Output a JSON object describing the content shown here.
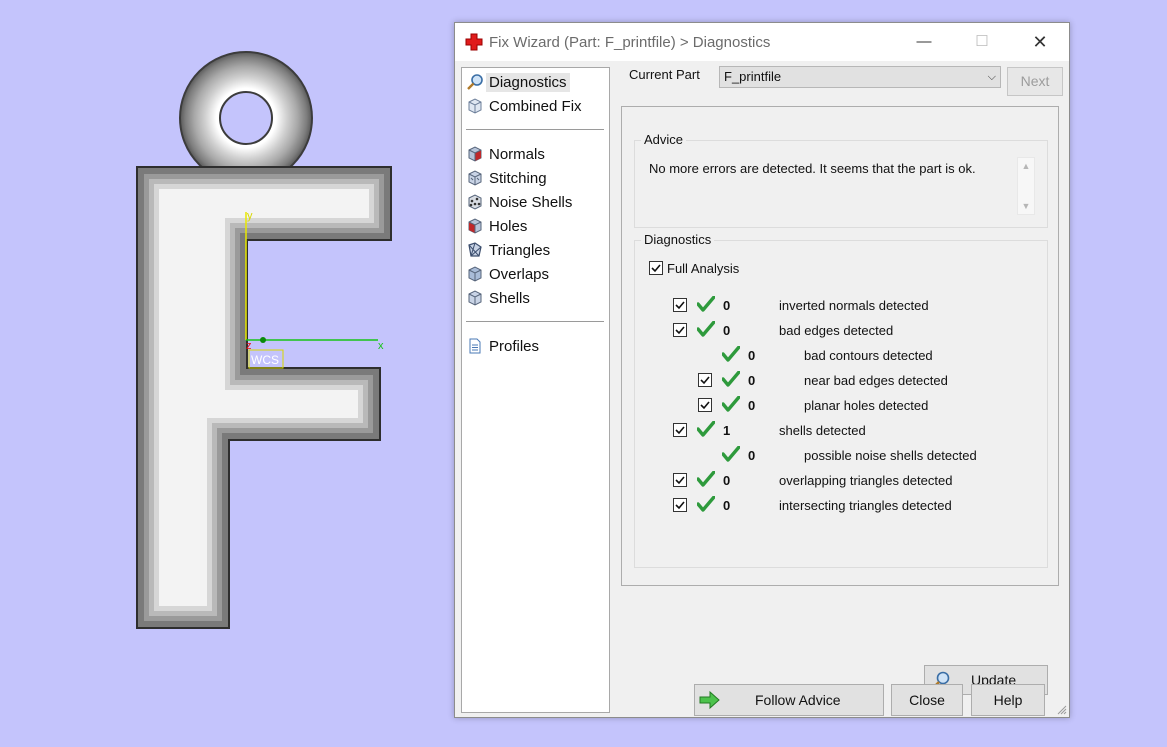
{
  "viewport": {
    "background": "#c4c4fc",
    "axis_y": "y",
    "axis_x": "x",
    "axis_z": "z",
    "wcs_label": "WCS"
  },
  "dialog": {
    "title": "Fix Wizard (Part: F_printfile) > Diagnostics",
    "title_icon": "red-cross-icon",
    "controls": {
      "minimize": "—",
      "maximize": "☐",
      "close": "✕"
    }
  },
  "nav": {
    "top_items": [
      {
        "label": "Diagnostics",
        "icon": "magnifier-icon",
        "selected": true
      },
      {
        "label": "Combined Fix",
        "icon": "cube-icon"
      }
    ],
    "fix_items": [
      {
        "label": "Normals",
        "icon": "normals-cube-icon"
      },
      {
        "label": "Stitching",
        "icon": "stitching-cube-icon"
      },
      {
        "label": "Noise Shells",
        "icon": "noise-shells-icon"
      },
      {
        "label": "Holes",
        "icon": "holes-cube-icon"
      },
      {
        "label": "Triangles",
        "icon": "triangles-icon"
      },
      {
        "label": "Overlaps",
        "icon": "overlaps-cube-icon"
      },
      {
        "label": "Shells",
        "icon": "shells-cube-icon"
      }
    ],
    "profiles": {
      "label": "Profiles",
      "icon": "document-icon"
    }
  },
  "current_part": {
    "label": "Current Part",
    "value": "F_printfile",
    "next_label": "Next"
  },
  "advice": {
    "title": "Advice",
    "text": "No more errors are detected. It seems that the part is ok."
  },
  "diagnostics": {
    "title": "Diagnostics",
    "full_analysis": {
      "label": "Full Analysis",
      "checked": true
    },
    "rows": [
      {
        "checkbox": true,
        "indent": 0,
        "count": "0",
        "label": "inverted normals detected"
      },
      {
        "checkbox": true,
        "indent": 0,
        "count": "0",
        "label": "bad edges detected"
      },
      {
        "checkbox": false,
        "indent": 1,
        "count": "0",
        "label": "bad contours detected"
      },
      {
        "checkbox": true,
        "indent": 1,
        "count": "0",
        "label": "near bad edges detected"
      },
      {
        "checkbox": true,
        "indent": 1,
        "count": "0",
        "label": "planar holes detected"
      },
      {
        "checkbox": true,
        "indent": 0,
        "count": "1",
        "label": "shells detected"
      },
      {
        "checkbox": false,
        "indent": 1,
        "count": "0",
        "label": "possible noise shells detected"
      },
      {
        "checkbox": true,
        "indent": 0,
        "count": "0",
        "label": "overlapping triangles detected"
      },
      {
        "checkbox": true,
        "indent": 0,
        "count": "0",
        "label": "intersecting triangles detected"
      }
    ],
    "update_label": "Update",
    "status_color": "#2e9a3c"
  },
  "buttons": {
    "follow_advice": "Follow Advice",
    "close": "Close",
    "help": "Help"
  }
}
